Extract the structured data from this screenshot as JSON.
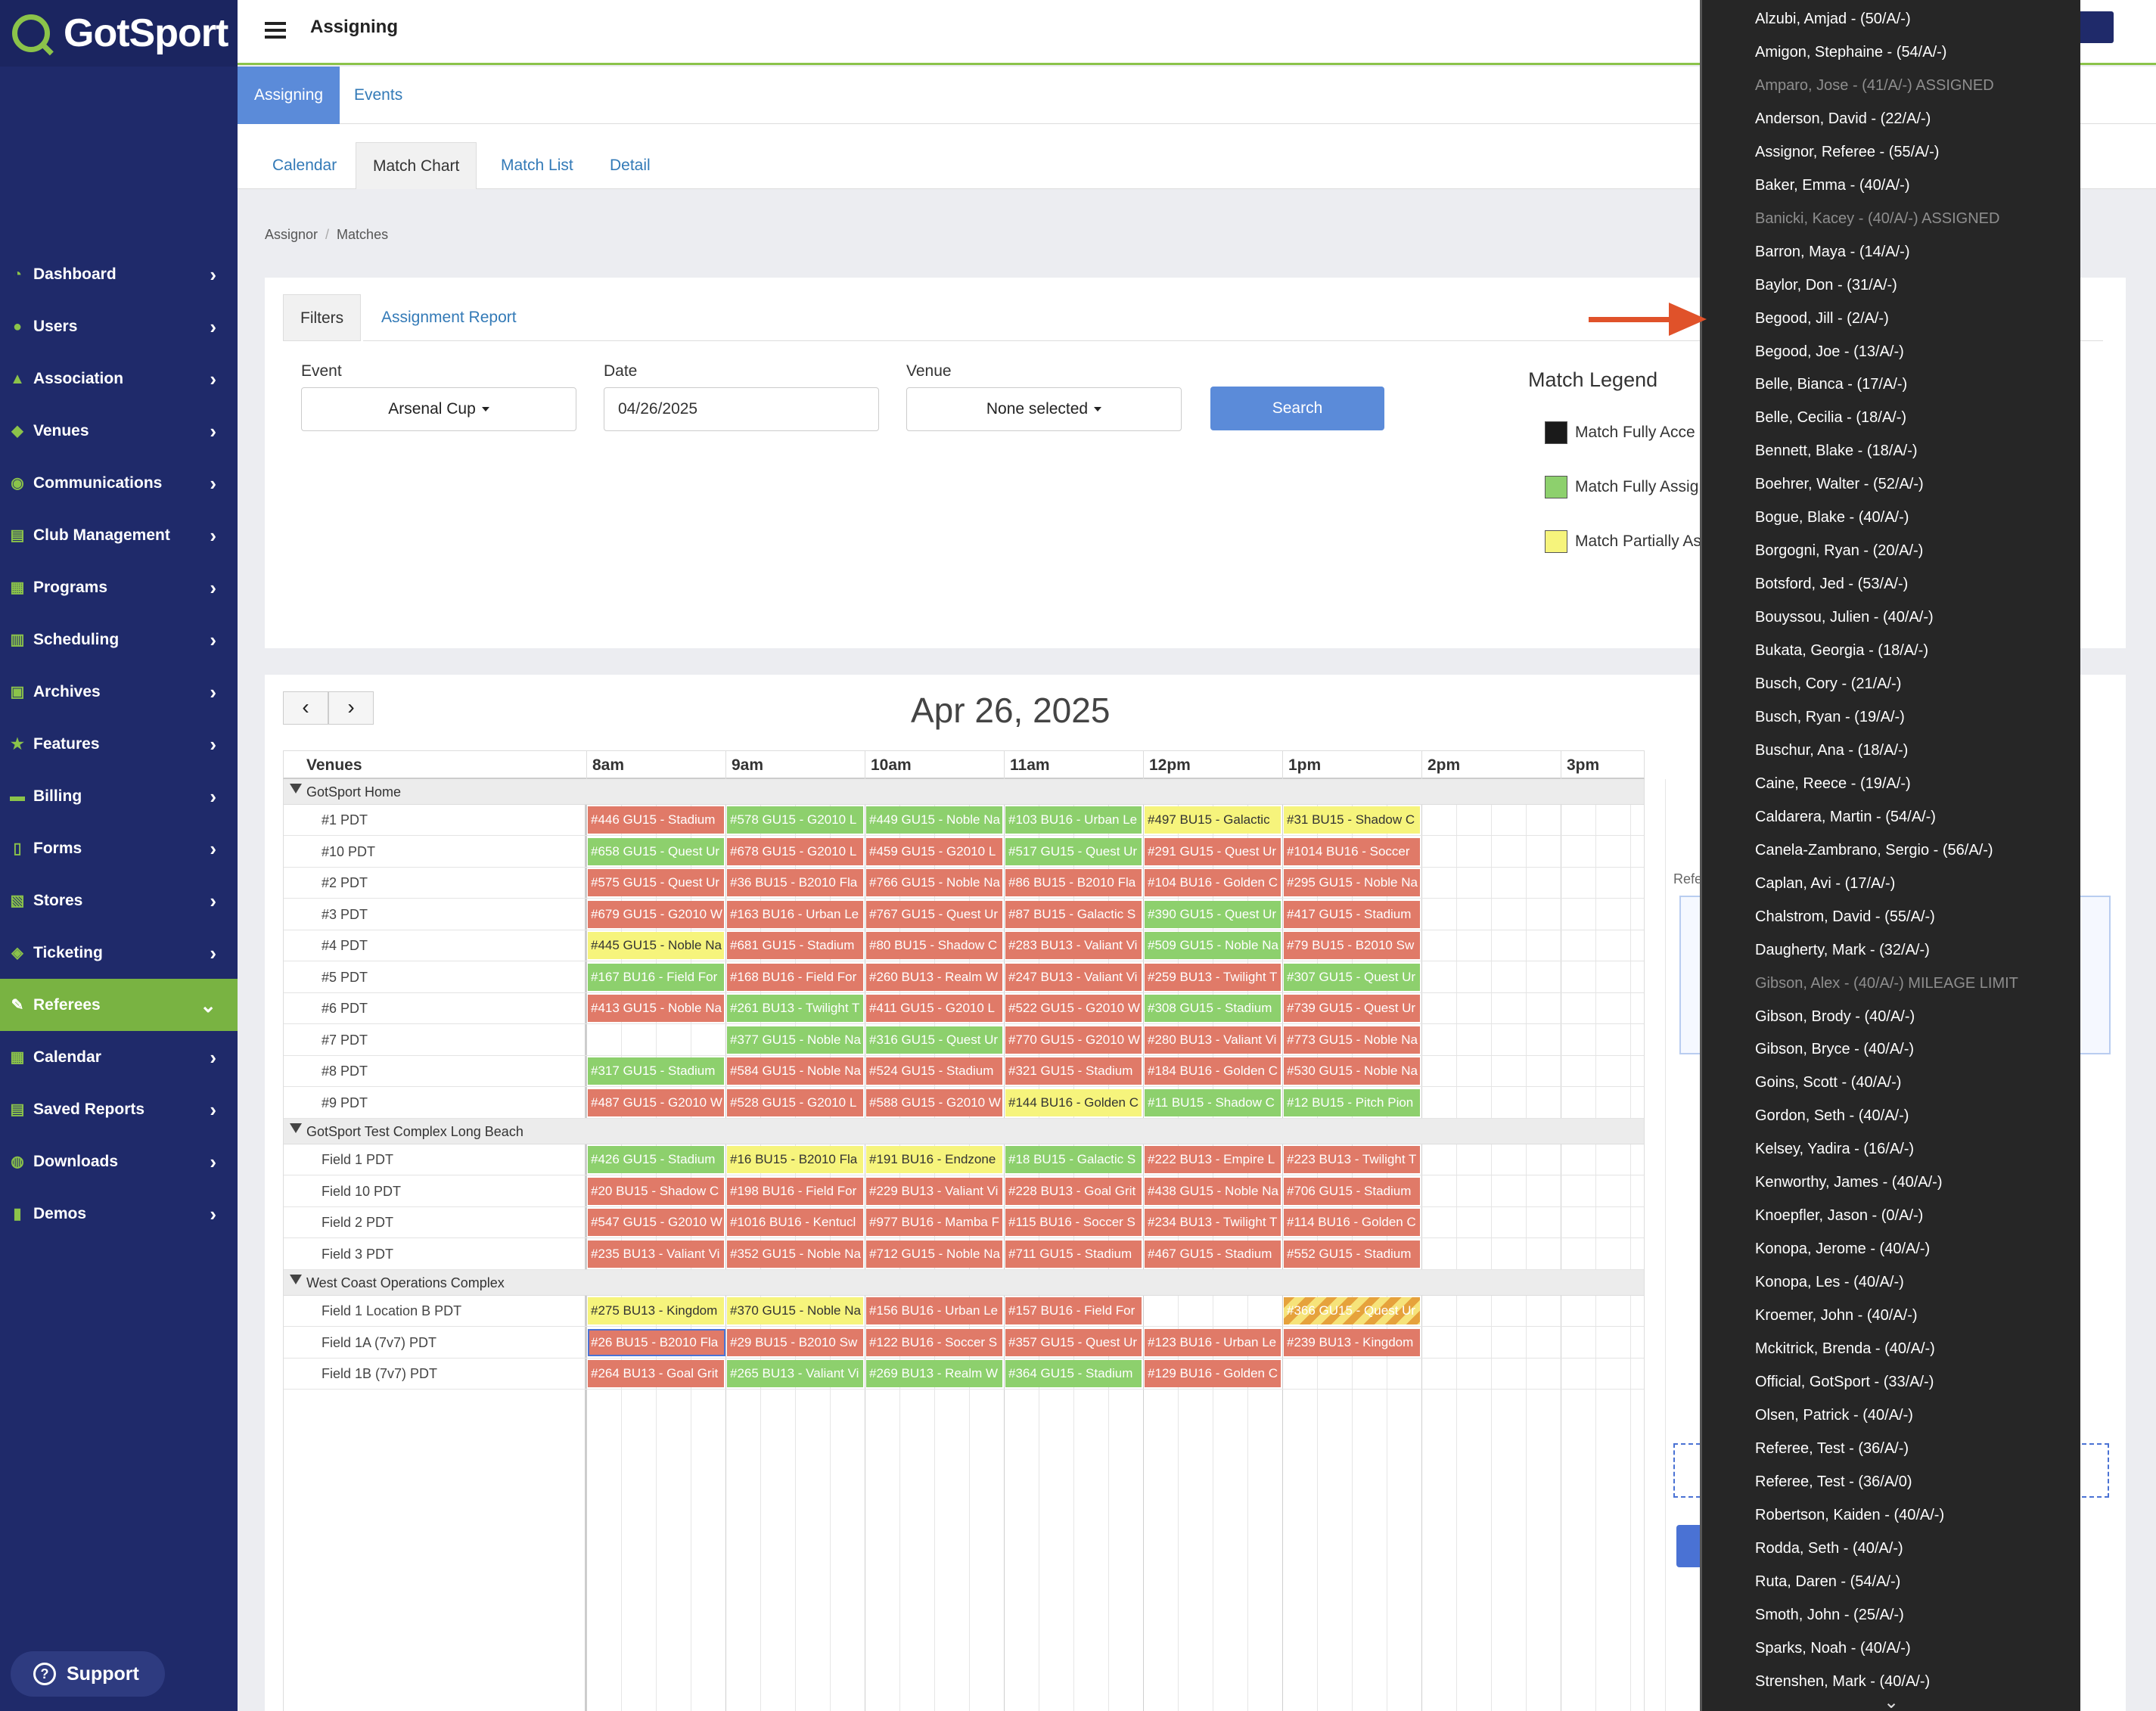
{
  "brand": {
    "logo_text": "GotSport",
    "green": "#8bc34a",
    "navy": "#1f2a6a"
  },
  "header": {
    "title": "Assigning"
  },
  "sidebar": {
    "items": [
      {
        "label": "Dashboard",
        "icon": "dashboard-icon"
      },
      {
        "label": "Users",
        "icon": "users-icon"
      },
      {
        "label": "Association",
        "icon": "association-icon"
      },
      {
        "label": "Venues",
        "icon": "venues-icon"
      },
      {
        "label": "Communications",
        "icon": "communications-icon"
      },
      {
        "label": "Club Management",
        "icon": "club-management-icon"
      },
      {
        "label": "Programs",
        "icon": "programs-icon"
      },
      {
        "label": "Scheduling",
        "icon": "scheduling-icon"
      },
      {
        "label": "Archives",
        "icon": "archives-icon"
      },
      {
        "label": "Features",
        "icon": "star-icon"
      },
      {
        "label": "Billing",
        "icon": "billing-icon"
      },
      {
        "label": "Forms",
        "icon": "forms-icon"
      },
      {
        "label": "Stores",
        "icon": "stores-icon"
      },
      {
        "label": "Ticketing",
        "icon": "ticket-icon"
      },
      {
        "label": "Referees",
        "icon": "whistle-icon",
        "active": true
      },
      {
        "label": "Calendar",
        "icon": "calendar-icon"
      },
      {
        "label": "Saved Reports",
        "icon": "saved-reports-icon"
      },
      {
        "label": "Downloads",
        "icon": "download-icon"
      },
      {
        "label": "Demos",
        "icon": "demos-icon"
      }
    ],
    "support_label": "Support"
  },
  "top_tabs": [
    "Assigning",
    "Events"
  ],
  "sub_tabs": [
    "Calendar",
    "Match Chart",
    "Match List",
    "Detail"
  ],
  "breadcrumb": [
    "Assignor",
    "Matches"
  ],
  "filters": {
    "tabs": [
      "Filters",
      "Assignment Report"
    ],
    "event_label": "Event",
    "event_value": "Arsenal Cup",
    "date_label": "Date",
    "date_value": "04/26/2025",
    "venue_label": "Venue",
    "venue_value": "None selected",
    "search_label": "Search"
  },
  "legend": {
    "title": "Match Legend",
    "items": [
      {
        "label": "Match Fully Acce",
        "color": "#1a1a1a"
      },
      {
        "label": "Match Fully Assig",
        "color": "#8dd06d"
      },
      {
        "label": "Match Partially As",
        "color": "#f6f47c"
      }
    ]
  },
  "chart": {
    "date_title": "Apr 26, 2025",
    "venues_header": "Venues",
    "hours": [
      "8am",
      "9am",
      "10am",
      "11am",
      "12pm",
      "1pm",
      "2pm",
      "3pm"
    ],
    "partial_ref_label": "Refe",
    "groups": [
      {
        "name": "GotSport Home",
        "rows": [
          {
            "venue": "#1 PDT",
            "cells": [
              {
                "text": "#446 GU15 - Stadium",
                "status": "r"
              },
              {
                "text": "#578 GU15 - G2010 L",
                "status": "g"
              },
              {
                "text": "#449 GU15 - Noble Na",
                "status": "g"
              },
              {
                "text": "#103 BU16 - Urban Le",
                "status": "g"
              },
              {
                "text": "#497 BU15 - Galactic",
                "status": "y"
              },
              {
                "text": "#31 BU15 - Shadow C",
                "status": "y"
              }
            ]
          },
          {
            "venue": "#10 PDT",
            "cells": [
              {
                "text": "#658 GU15 - Quest Ur",
                "status": "g"
              },
              {
                "text": "#678 GU15 - G2010 L",
                "status": "r"
              },
              {
                "text": "#459 GU15 - G2010 L",
                "status": "r"
              },
              {
                "text": "#517 GU15 - Quest Ur",
                "status": "g"
              },
              {
                "text": "#291 GU15 - Quest Ur",
                "status": "r"
              },
              {
                "text": "#1014 BU16 - Soccer",
                "status": "r"
              }
            ]
          },
          {
            "venue": "#2 PDT",
            "cells": [
              {
                "text": "#575 GU15 - Quest Ur",
                "status": "r"
              },
              {
                "text": "#36 BU15 - B2010 Fla",
                "status": "r"
              },
              {
                "text": "#766 GU15 - Noble Na",
                "status": "r"
              },
              {
                "text": "#86 BU15 - B2010 Fla",
                "status": "r"
              },
              {
                "text": "#104 BU16 - Golden C",
                "status": "r"
              },
              {
                "text": "#295 GU15 - Noble Na",
                "status": "r"
              }
            ]
          },
          {
            "venue": "#3 PDT",
            "cells": [
              {
                "text": "#679 GU15 - G2010 W",
                "status": "r"
              },
              {
                "text": "#163 BU16 - Urban Le",
                "status": "r"
              },
              {
                "text": "#767 GU15 - Quest Ur",
                "status": "r"
              },
              {
                "text": "#87 BU15 - Galactic S",
                "status": "r"
              },
              {
                "text": "#390 GU15 - Quest Ur",
                "status": "g"
              },
              {
                "text": "#417 GU15 - Stadium",
                "status": "r"
              }
            ]
          },
          {
            "venue": "#4 PDT",
            "cells": [
              {
                "text": "#445 GU15 - Noble Na",
                "status": "y"
              },
              {
                "text": "#681 GU15 - Stadium",
                "status": "r"
              },
              {
                "text": "#80 BU15 - Shadow C",
                "status": "r"
              },
              {
                "text": "#283 BU13 - Valiant Vi",
                "status": "r"
              },
              {
                "text": "#509 GU15 - Noble Na",
                "status": "g"
              },
              {
                "text": "#79 BU15 - B2010 Sw",
                "status": "r"
              }
            ]
          },
          {
            "venue": "#5 PDT",
            "cells": [
              {
                "text": "#167 BU16 - Field For",
                "status": "g"
              },
              {
                "text": "#168 BU16 - Field For",
                "status": "r"
              },
              {
                "text": "#260 BU13 - Realm W",
                "status": "r"
              },
              {
                "text": "#247 BU13 - Valiant Vi",
                "status": "r"
              },
              {
                "text": "#259 BU13 - Twilight T",
                "status": "r"
              },
              {
                "text": "#307 GU15 - Quest Ur",
                "status": "g"
              }
            ]
          },
          {
            "venue": "#6 PDT",
            "cells": [
              {
                "text": "#413 GU15 - Noble Na",
                "status": "r"
              },
              {
                "text": "#261 BU13 - Twilight T",
                "status": "g"
              },
              {
                "text": "#411 GU15 - G2010 L",
                "status": "r"
              },
              {
                "text": "#522 GU15 - G2010 W",
                "status": "r"
              },
              {
                "text": "#308 GU15 - Stadium",
                "status": "g"
              },
              {
                "text": "#739 GU15 - Quest Ur",
                "status": "r"
              }
            ]
          },
          {
            "venue": "#7 PDT",
            "cells": [
              {
                "text": "",
                "status": "none"
              },
              {
                "text": "#377 GU15 - Noble Na",
                "status": "g"
              },
              {
                "text": "#316 GU15 - Quest Ur",
                "status": "g"
              },
              {
                "text": "#770 GU15 - G2010 W",
                "status": "r"
              },
              {
                "text": "#280 BU13 - Valiant Vi",
                "status": "r"
              },
              {
                "text": "#773 GU15 - Noble Na",
                "status": "r"
              }
            ]
          },
          {
            "venue": "#8 PDT",
            "cells": [
              {
                "text": "#317 GU15 - Stadium",
                "status": "g"
              },
              {
                "text": "#584 GU15 - Noble Na",
                "status": "r"
              },
              {
                "text": "#524 GU15 - Stadium",
                "status": "r"
              },
              {
                "text": "#321 GU15 - Stadium",
                "status": "r"
              },
              {
                "text": "#184 BU16 - Golden C",
                "status": "r"
              },
              {
                "text": "#530 GU15 - Noble Na",
                "status": "r"
              }
            ]
          },
          {
            "venue": "#9 PDT",
            "cells": [
              {
                "text": "#487 GU15 - G2010 W",
                "status": "r"
              },
              {
                "text": "#528 GU15 - G2010 L",
                "status": "r"
              },
              {
                "text": "#588 GU15 - G2010 W",
                "status": "r"
              },
              {
                "text": "#144 BU16 - Golden C",
                "status": "y"
              },
              {
                "text": "#11 BU15 - Shadow C",
                "status": "g"
              },
              {
                "text": "#12 BU15 - Pitch Pion",
                "status": "g"
              }
            ]
          }
        ]
      },
      {
        "name": "GotSport Test Complex Long Beach",
        "rows": [
          {
            "venue": "Field 1 PDT",
            "cells": [
              {
                "text": "#426 GU15 - Stadium",
                "status": "g"
              },
              {
                "text": "#16 BU15 - B2010 Fla",
                "status": "y"
              },
              {
                "text": "#191 BU16 - Endzone",
                "status": "y"
              },
              {
                "text": "#18 BU15 - Galactic S",
                "status": "g"
              },
              {
                "text": "#222 BU13 - Empire L",
                "status": "r"
              },
              {
                "text": "#223 BU13 - Twilight T",
                "status": "r"
              }
            ]
          },
          {
            "venue": "Field 10 PDT",
            "cells": [
              {
                "text": "#20 BU15 - Shadow C",
                "status": "r"
              },
              {
                "text": "#198 BU16 - Field For",
                "status": "r"
              },
              {
                "text": "#229 BU13 - Valiant Vi",
                "status": "r"
              },
              {
                "text": "#228 BU13 - Goal Grit",
                "status": "r"
              },
              {
                "text": "#438 GU15 - Noble Na",
                "status": "r"
              },
              {
                "text": "#706 GU15 - Stadium",
                "status": "r"
              }
            ]
          },
          {
            "venue": "Field 2 PDT",
            "cells": [
              {
                "text": "#547 GU15 - G2010 W",
                "status": "r"
              },
              {
                "text": "#1016 BU16 - Kentucl",
                "status": "r"
              },
              {
                "text": "#977 BU16 - Mamba F",
                "status": "r"
              },
              {
                "text": "#115 BU16 - Soccer S",
                "status": "r"
              },
              {
                "text": "#234 BU13 - Twilight T",
                "status": "r"
              },
              {
                "text": "#114 BU16 - Golden C",
                "status": "r"
              }
            ]
          },
          {
            "venue": "Field 3 PDT",
            "cells": [
              {
                "text": "#235 BU13 - Valiant Vi",
                "status": "r"
              },
              {
                "text": "#352 GU15 - Noble Na",
                "status": "r"
              },
              {
                "text": "#712 GU15 - Noble Na",
                "status": "r"
              },
              {
                "text": "#711 GU15 - Stadium",
                "status": "r"
              },
              {
                "text": "#467 GU15 - Stadium",
                "status": "r"
              },
              {
                "text": "#552 GU15 - Stadium",
                "status": "r"
              }
            ]
          }
        ]
      },
      {
        "name": "West Coast Operations Complex",
        "rows": [
          {
            "venue": "Field 1 Location B PDT",
            "cells": [
              {
                "text": "#275 BU13 - Kingdom",
                "status": "y"
              },
              {
                "text": "#370 GU15 - Noble Na",
                "status": "y"
              },
              {
                "text": "#156 BU16 - Urban Le",
                "status": "r"
              },
              {
                "text": "#157 BU16 - Field For",
                "status": "r"
              },
              {
                "text": "",
                "status": "none"
              },
              {
                "text": "#366 GU15 - Quest Ur",
                "status": "s"
              }
            ]
          },
          {
            "venue": "Field 1A (7v7) PDT",
            "cells": [
              {
                "text": "#26 BU15 - B2010 Fla",
                "status": "r",
                "selected": true
              },
              {
                "text": "#29 BU15 - B2010 Sw",
                "status": "r"
              },
              {
                "text": "#122 BU16 - Soccer S",
                "status": "r"
              },
              {
                "text": "#357 GU15 - Quest Ur",
                "status": "r"
              },
              {
                "text": "#123 BU16 - Urban Le",
                "status": "r"
              },
              {
                "text": "#239 BU13 - Kingdom",
                "status": "r"
              }
            ]
          },
          {
            "venue": "Field 1B (7v7) PDT",
            "cells": [
              {
                "text": "#264 BU13 - Goal Grit",
                "status": "r"
              },
              {
                "text": "#265 BU13 - Valiant Vi",
                "status": "g"
              },
              {
                "text": "#269 BU13 - Realm W",
                "status": "g"
              },
              {
                "text": "#364 GU15 - Stadium",
                "status": "g"
              },
              {
                "text": "#129 BU16 - Golden C",
                "status": "r"
              }
            ]
          }
        ]
      }
    ]
  },
  "dropdown": {
    "options": [
      {
        "text": "Alzubi, Amjad - (50/A/-)"
      },
      {
        "text": "Amigon, Stephaine - (54/A/-)"
      },
      {
        "text": "Amparo, Jose - (41/A/-) ASSIGNED",
        "disabled": true
      },
      {
        "text": "Anderson, David - (22/A/-)"
      },
      {
        "text": "Assignor, Referee - (55/A/-)"
      },
      {
        "text": "Baker, Emma - (40/A/-)"
      },
      {
        "text": "Banicki, Kacey - (40/A/-) ASSIGNED",
        "disabled": true
      },
      {
        "text": "Barron, Maya - (14/A/-)"
      },
      {
        "text": "Baylor, Don - (31/A/-)"
      },
      {
        "text": "Begood, Jill - (2/A/-)"
      },
      {
        "text": "Begood, Joe - (13/A/-)"
      },
      {
        "text": "Belle, Bianca - (17/A/-)"
      },
      {
        "text": "Belle, Cecilia - (18/A/-)"
      },
      {
        "text": "Bennett, Blake - (18/A/-)"
      },
      {
        "text": "Boehrer, Walter - (52/A/-)"
      },
      {
        "text": "Bogue, Blake - (40/A/-)"
      },
      {
        "text": "Borgogni, Ryan - (20/A/-)"
      },
      {
        "text": "Botsford, Jed - (53/A/-)"
      },
      {
        "text": "Bouyssou, Julien - (40/A/-)"
      },
      {
        "text": "Bukata, Georgia - (18/A/-)"
      },
      {
        "text": "Busch, Cory - (21/A/-)"
      },
      {
        "text": "Busch, Ryan - (19/A/-)"
      },
      {
        "text": "Buschur, Ana - (18/A/-)"
      },
      {
        "text": "Caine, Reece - (19/A/-)"
      },
      {
        "text": "Caldarera, Martin - (54/A/-)"
      },
      {
        "text": "Canela-Zambrano, Sergio - (56/A/-)"
      },
      {
        "text": "Caplan, Avi - (17/A/-)"
      },
      {
        "text": "Chalstrom, David - (55/A/-)"
      },
      {
        "text": "Daugherty, Mark - (32/A/-)"
      },
      {
        "text": "Gibson, Alex - (40/A/-) MILEAGE LIMIT",
        "disabled": true
      },
      {
        "text": "Gibson, Brody - (40/A/-)"
      },
      {
        "text": "Gibson, Bryce - (40/A/-)"
      },
      {
        "text": "Goins, Scott - (40/A/-)"
      },
      {
        "text": "Gordon, Seth - (40/A/-)"
      },
      {
        "text": "Kelsey, Yadira - (16/A/-)"
      },
      {
        "text": "Kenworthy, James - (40/A/-)"
      },
      {
        "text": "Knoepfler, Jason - (0/A/-)"
      },
      {
        "text": "Konopa, Jerome - (40/A/-)"
      },
      {
        "text": "Konopa, Les - (40/A/-)"
      },
      {
        "text": "Kroemer, John - (40/A/-)"
      },
      {
        "text": "Mckitrick, Brenda - (40/A/-)"
      },
      {
        "text": "Official, GotSport - (33/A/-)"
      },
      {
        "text": "Olsen, Patrick - (40/A/-)"
      },
      {
        "text": "Referee, Test - (36/A/-)"
      },
      {
        "text": "Referee, Test - (36/A/0)"
      },
      {
        "text": "Robertson, Kaiden - (40/A/-)"
      },
      {
        "text": "Rodda, Seth - (40/A/-)"
      },
      {
        "text": "Ruta, Daren - (54/A/-)"
      },
      {
        "text": "Smoth, John - (25/A/-)"
      },
      {
        "text": "Sparks, Noah - (40/A/-)"
      },
      {
        "text": "Strenshen, Mark - (40/A/-)"
      }
    ]
  }
}
